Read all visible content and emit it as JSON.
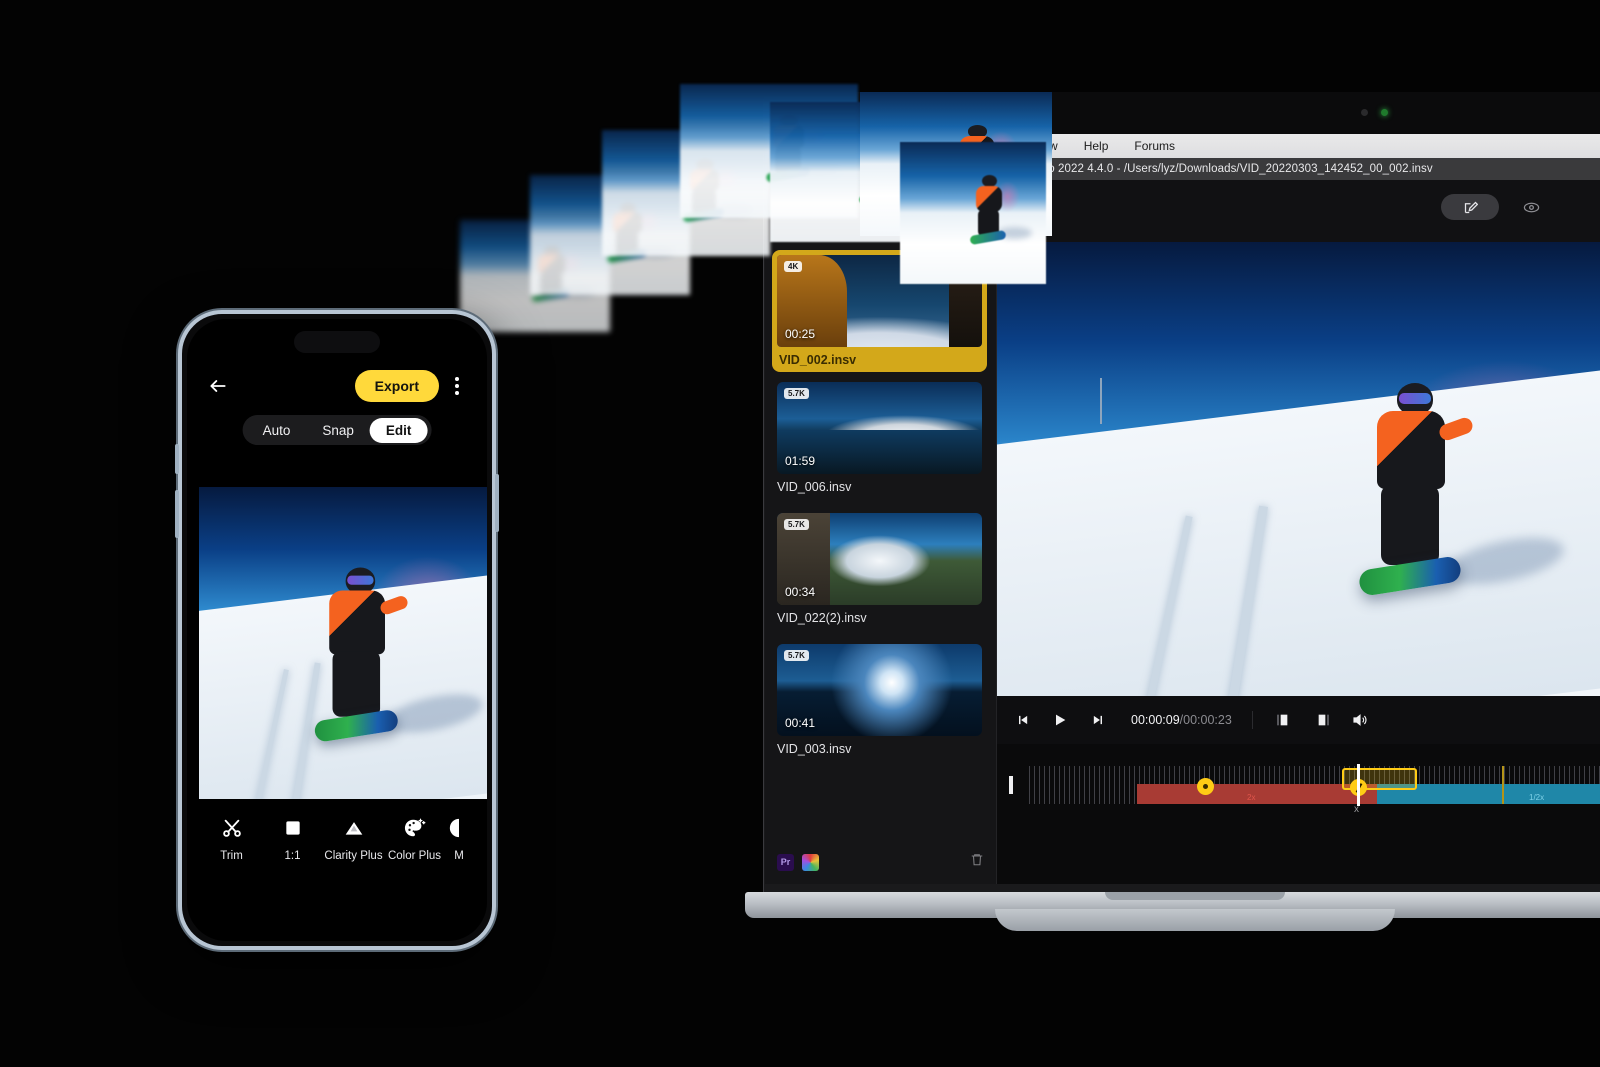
{
  "scene": {
    "description": "Insta360 Studio 2022 on a MacBook Pro beside a smartphone running the Insta360 mobile editor"
  },
  "desktop": {
    "menubar": {
      "items": [
        "Window",
        "Help",
        "Forums"
      ]
    },
    "titlebar": {
      "text": "Insta360 Studio 2022 4.4.0 - /Users/lyz/Downloads/VID_20220303_142452_00_002.insv"
    },
    "toolbar": {
      "sort_icon": "list-sort-icon",
      "edit_button_icon": "edit-pencil-icon",
      "preview_icon": "eye-icon"
    },
    "sidebar": {
      "clips": [
        {
          "name": "VID_002.insv",
          "duration": "00:25",
          "quality": "4K",
          "selected": true
        },
        {
          "name": "VID_006.insv",
          "duration": "01:59",
          "quality": "5.7K",
          "selected": false
        },
        {
          "name": "VID_022(2).insv",
          "duration": "00:34",
          "quality": "5.7K",
          "selected": false
        },
        {
          "name": "VID_003.insv",
          "duration": "00:41",
          "quality": "5.7K",
          "selected": false
        }
      ],
      "footer": {
        "premiere_label": "Pr",
        "palette_icon": "color-palette-icon",
        "delete_icon": "trash-icon"
      }
    },
    "transport": {
      "prev_icon": "skip-previous-icon",
      "play_icon": "play-icon",
      "next_icon": "skip-next-icon",
      "current_time": "00:00:09",
      "separator": "/",
      "total_time": "00:00:23",
      "mark_in_icon": "mark-in-icon",
      "mark_out_icon": "mark-out-icon",
      "volume_icon": "volume-icon"
    },
    "timeline": {
      "speed_label_left": "2x",
      "speed_label_right": "1/2x",
      "cut_marker": "x",
      "keyframe_icons": [
        "keyframe-dot-icon",
        "keyframe-speed-icon"
      ],
      "colors": {
        "speed_segment": "#a83b34",
        "normal_segment": "#1f87a8",
        "accent": "#ffcc15"
      }
    }
  },
  "phone": {
    "header": {
      "back_icon": "back-arrow-icon",
      "export_label": "Export",
      "more_icon": "more-vertical-icon"
    },
    "modes": [
      {
        "label": "Auto",
        "active": false
      },
      {
        "label": "Snap",
        "active": false
      },
      {
        "label": "Edit",
        "active": true
      }
    ],
    "tools": [
      {
        "label": "Trim",
        "icon": "scissors-icon"
      },
      {
        "label": "1:1",
        "icon": "aspect-ratio-icon"
      },
      {
        "label": "Clarity Plus",
        "icon": "clarity-triangle-icon"
      },
      {
        "label": "Color Plus",
        "icon": "color-palette-icon"
      },
      {
        "label": "M",
        "icon": "partial-circle-icon"
      }
    ]
  },
  "colors": {
    "accent_yellow": "#ffd93b",
    "selected_clip": "#d3a81a",
    "app_background": "#151517"
  }
}
